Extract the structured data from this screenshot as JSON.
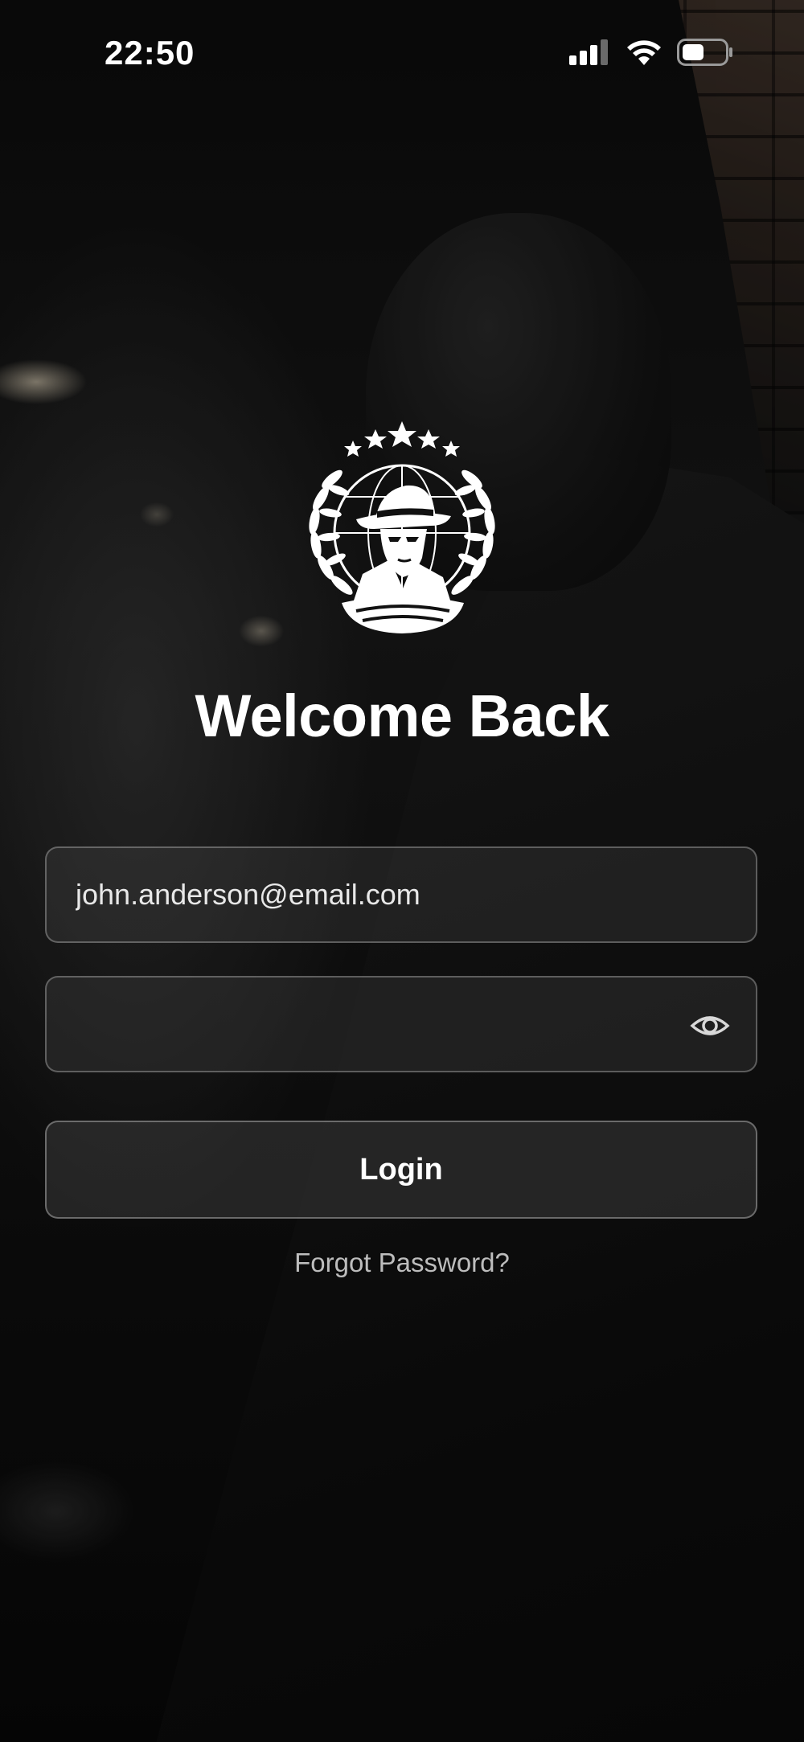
{
  "status_bar": {
    "time": "22:50",
    "icons": [
      "cellular-signal-icon",
      "wifi-icon",
      "battery-icon"
    ]
  },
  "logo": {
    "icon": "detective-emblem-logo"
  },
  "title": "Welcome Back",
  "form": {
    "email_value": "john.anderson@email.com",
    "password_value": "",
    "password_toggle_icon": "eye-icon",
    "login_label": "Login",
    "forgot_label": "Forgot Password?"
  },
  "colors": {
    "text": "#ffffff",
    "muted": "#bdbdbd",
    "field_border": "#5a5a5a"
  }
}
